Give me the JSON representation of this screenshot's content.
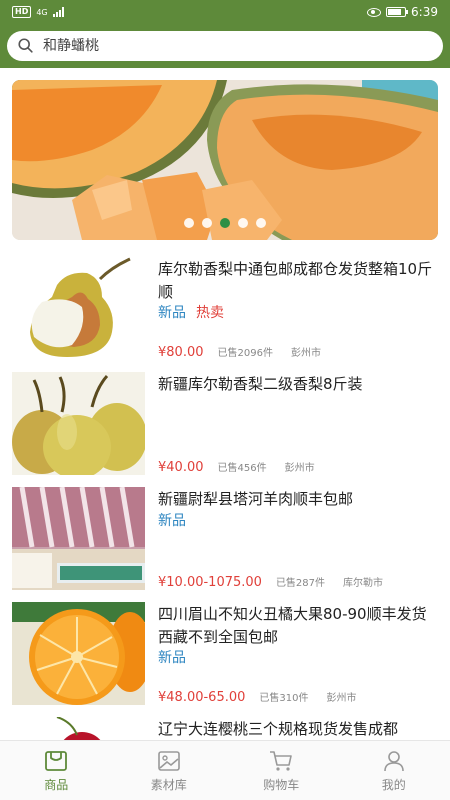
{
  "status_bar": {
    "network": "HD",
    "signal_type": "4G",
    "time": "6:39"
  },
  "search": {
    "placeholder": "和静蟠桃"
  },
  "banner": {
    "slides_count": 5,
    "active_index": 2
  },
  "products": [
    {
      "title": "库尔勒香梨中通包邮成都仓发货整箱10斤顺",
      "tags": [
        "新品",
        "热卖"
      ],
      "price": "¥80.00",
      "sold": "已售2096件",
      "location": "彭州市"
    },
    {
      "title": "新疆库尔勒香梨二级香梨8斤装",
      "tags": [],
      "price": "¥40.00",
      "sold": "已售456件",
      "location": "彭州市"
    },
    {
      "title": "新疆尉犁县塔河羊肉顺丰包邮",
      "tags": [
        "新品"
      ],
      "price": "¥10.00-1075.00",
      "sold": "已售287件",
      "location": "库尔勒市"
    },
    {
      "title": "四川眉山不知火丑橘大果80-90顺丰发货西藏不到全国包邮",
      "tags": [
        "新品"
      ],
      "price": "¥48.00-65.00",
      "sold": "已售310件",
      "location": "彭州市"
    },
    {
      "title": "辽宁大连樱桃三个规格现货发售成都",
      "tags": [],
      "price": "",
      "sold": "",
      "location": ""
    }
  ],
  "nav": {
    "items": [
      {
        "label": "商品",
        "icon": "bag-icon",
        "active": true
      },
      {
        "label": "素材库",
        "icon": "image-icon",
        "active": false
      },
      {
        "label": "购物车",
        "icon": "cart-icon",
        "active": false
      },
      {
        "label": "我的",
        "icon": "user-icon",
        "active": false
      }
    ]
  },
  "colors": {
    "brand_green": "#5e8a3a",
    "price_red": "#e0403a",
    "tag_blue": "#2e86c1"
  }
}
